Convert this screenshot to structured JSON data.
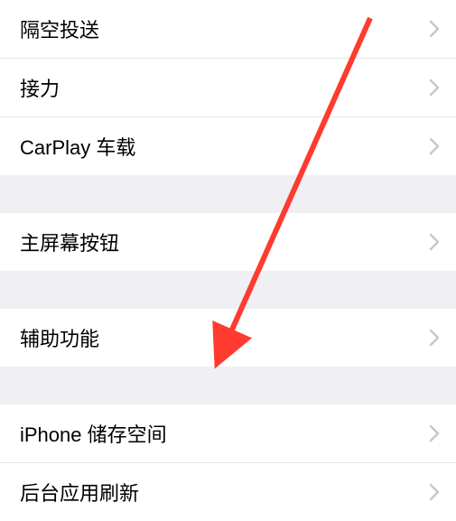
{
  "groups": [
    {
      "items": [
        {
          "label": "隔空投送"
        },
        {
          "label": "接力"
        },
        {
          "label": "CarPlay 车载"
        }
      ]
    },
    {
      "items": [
        {
          "label": "主屏幕按钮"
        }
      ]
    },
    {
      "items": [
        {
          "label": "辅助功能"
        }
      ]
    },
    {
      "items": [
        {
          "label": "iPhone 储存空间"
        },
        {
          "label": "后台应用刷新"
        }
      ]
    }
  ]
}
